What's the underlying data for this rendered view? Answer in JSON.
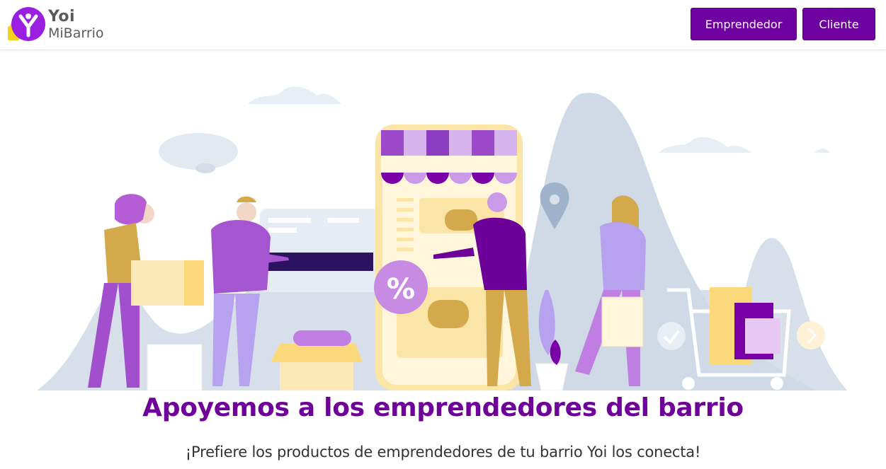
{
  "brand": {
    "name_line_1": "Yoi",
    "name_line_2": "MiBarrio",
    "logo_icon": "y-circle-bag-logo",
    "primary_color": "#6f00a0",
    "accent_yellow": "#f5d21a"
  },
  "nav": {
    "buttons": [
      {
        "label": "Emprendedor"
      },
      {
        "label": "Cliente"
      }
    ]
  },
  "hero": {
    "illustration": "neighborhood-shopping-illustration",
    "badge_text": "%"
  },
  "main": {
    "headline": "Apoyemos a los emprendedores del barrio",
    "tagline": "¡Prefiere los productos de emprendedores de tu barrio Yoi los conecta!"
  }
}
